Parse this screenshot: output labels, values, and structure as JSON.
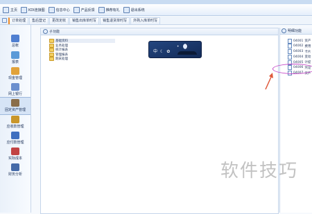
{
  "toolbar": {
    "items": [
      {
        "label": "主页",
        "icon": "home-icon"
      },
      {
        "label": "KDI连接图",
        "icon": "connect-icon"
      },
      {
        "label": "信息中心",
        "icon": "info-icon"
      },
      {
        "label": "产品反馈",
        "icon": "feedback-icon"
      },
      {
        "label": "推荐有礼",
        "icon": "gift-icon"
      },
      {
        "label": "退出系统",
        "icon": "exit-icon"
      }
    ]
  },
  "tabs": [
    "订单处理",
    "售后登记",
    "更改定收",
    "销售出库单时写",
    "销售退货单时写",
    "外购入库单时写"
  ],
  "sidebar": {
    "items": [
      {
        "label": "总帐",
        "color": "#4f7fd1"
      },
      {
        "label": "报表",
        "color": "#5a9ad8"
      },
      {
        "label": "现金管理",
        "color": "#e1a23a"
      },
      {
        "label": "网上银行",
        "color": "#6b8fce"
      },
      {
        "label": "固定资产管理",
        "color": "#8a6d49"
      },
      {
        "label": "应收款管理",
        "color": "#c9962a"
      },
      {
        "label": "应付款管理",
        "color": "#3f6fbf"
      },
      {
        "label": "实际成本",
        "color": "#c24444"
      },
      {
        "label": "财务分析",
        "color": "#446aa8"
      }
    ],
    "active_index": 4
  },
  "function_panel": {
    "title": "子功能",
    "tree": [
      "基础资料",
      "业务处理",
      "统计报表",
      "管理报表",
      "期末处理"
    ],
    "selected_index": 0
  },
  "clock_widget": {
    "text": "中 ☾ ✿"
  },
  "detail_panel": {
    "title": "明细功能",
    "rows": [
      {
        "code": "04001",
        "name": "资产"
      },
      {
        "code": "04002",
        "name": "费用"
      },
      {
        "code": "04003",
        "name": "卡片"
      },
      {
        "code": "04004",
        "name": "变动"
      },
      {
        "code": "04005",
        "name": "计提"
      },
      {
        "code": "04006",
        "name": "凭证"
      },
      {
        "code": "04007",
        "name": "资产"
      }
    ]
  },
  "watermark": "软件技巧",
  "accent_color": "#f08a24",
  "annotation_color": "#c548c8",
  "arrow_color": "#e05a3c"
}
